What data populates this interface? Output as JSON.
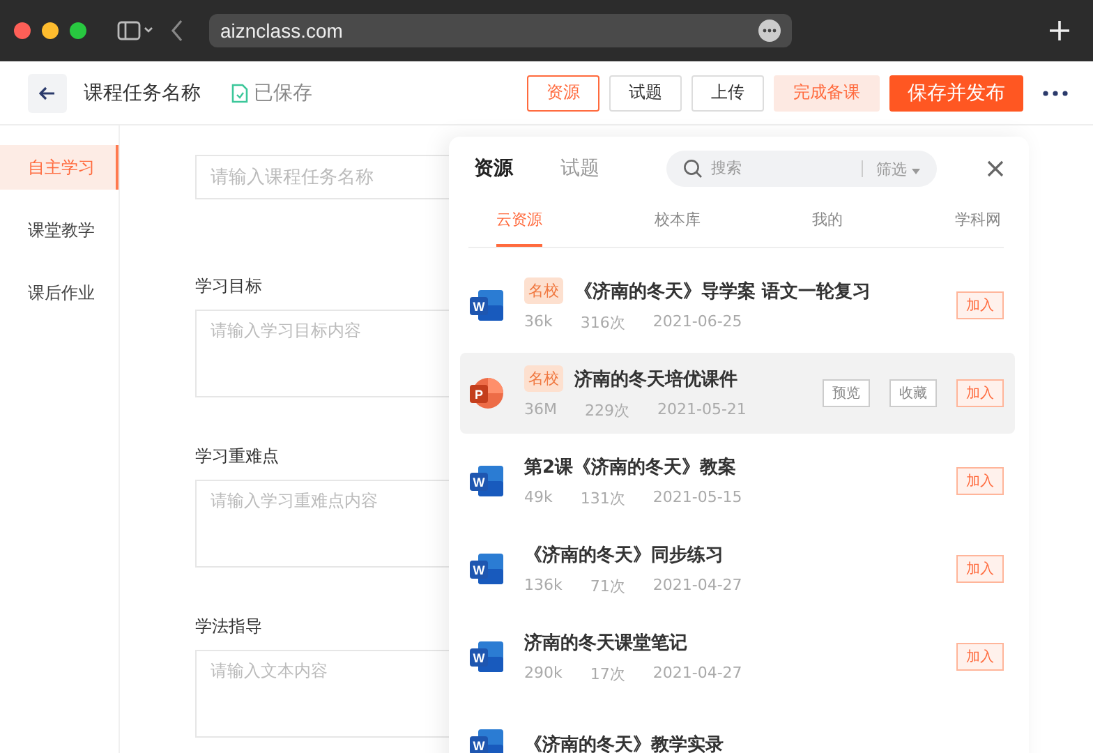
{
  "browser": {
    "url": "aiznclass.com"
  },
  "toolbar": {
    "title": "课程任务名称",
    "save_status": "已保存",
    "buttons": [
      {
        "label": "资源",
        "kind": "outline"
      },
      {
        "label": "试题",
        "kind": "plain"
      },
      {
        "label": "上传",
        "kind": "plain"
      },
      {
        "label": "完成备课",
        "kind": "soft"
      },
      {
        "label": "保存并发布",
        "kind": "primary"
      }
    ]
  },
  "sidebar": {
    "items": [
      {
        "label": "自主学习",
        "selected": true
      },
      {
        "label": "课堂教学",
        "selected": false
      },
      {
        "label": "课后作业",
        "selected": false
      }
    ]
  },
  "form": {
    "name_placeholder": "请输入课程任务名称",
    "sections": [
      {
        "label": "学习目标",
        "placeholder": "请输入学习目标内容"
      },
      {
        "label": "学习重难点",
        "placeholder": "请输入学习重难点内容"
      },
      {
        "label": "学法指导",
        "placeholder": "请输入文本内容"
      }
    ]
  },
  "panel": {
    "tabs": [
      {
        "label": "资源",
        "selected": true
      },
      {
        "label": "试题",
        "selected": false
      }
    ],
    "search": {
      "placeholder": "搜索",
      "filter": "筛选"
    },
    "subtabs": [
      {
        "label": "云资源",
        "selected": true
      },
      {
        "label": "校本库",
        "selected": false
      },
      {
        "label": "我的",
        "selected": false
      },
      {
        "label": "学科网",
        "selected": false
      }
    ],
    "items": [
      {
        "kind": "word",
        "icon_letter": "W",
        "badge": "名校",
        "title": "《济南的冬天》导学案 语文一轮复习",
        "size": "36k",
        "count": "316次",
        "date": "2021-06-25",
        "hovered": false,
        "add": "加入"
      },
      {
        "kind": "ppt",
        "icon_letter": "P",
        "badge": "名校",
        "title": "济南的冬天培优课件",
        "size": "36M",
        "count": "229次",
        "date": "2021-05-21",
        "hovered": true,
        "actions": [
          "预览",
          "收藏"
        ],
        "add": "加入"
      },
      {
        "kind": "word",
        "icon_letter": "W",
        "title": "第2课《济南的冬天》教案",
        "size": "49k",
        "count": "131次",
        "date": "2021-05-15",
        "hovered": false,
        "add": "加入"
      },
      {
        "kind": "word",
        "icon_letter": "W",
        "title": "《济南的冬天》同步练习",
        "size": "136k",
        "count": "71次",
        "date": "2021-04-27",
        "hovered": false,
        "add": "加入"
      },
      {
        "kind": "word",
        "icon_letter": "W",
        "title": "济南的冬天课堂笔记",
        "size": "290k",
        "count": "17次",
        "date": "2021-04-27",
        "hovered": false,
        "add": "加入"
      },
      {
        "kind": "word",
        "icon_letter": "W",
        "title": "《济南的冬天》教学实录",
        "hovered": false
      }
    ]
  }
}
